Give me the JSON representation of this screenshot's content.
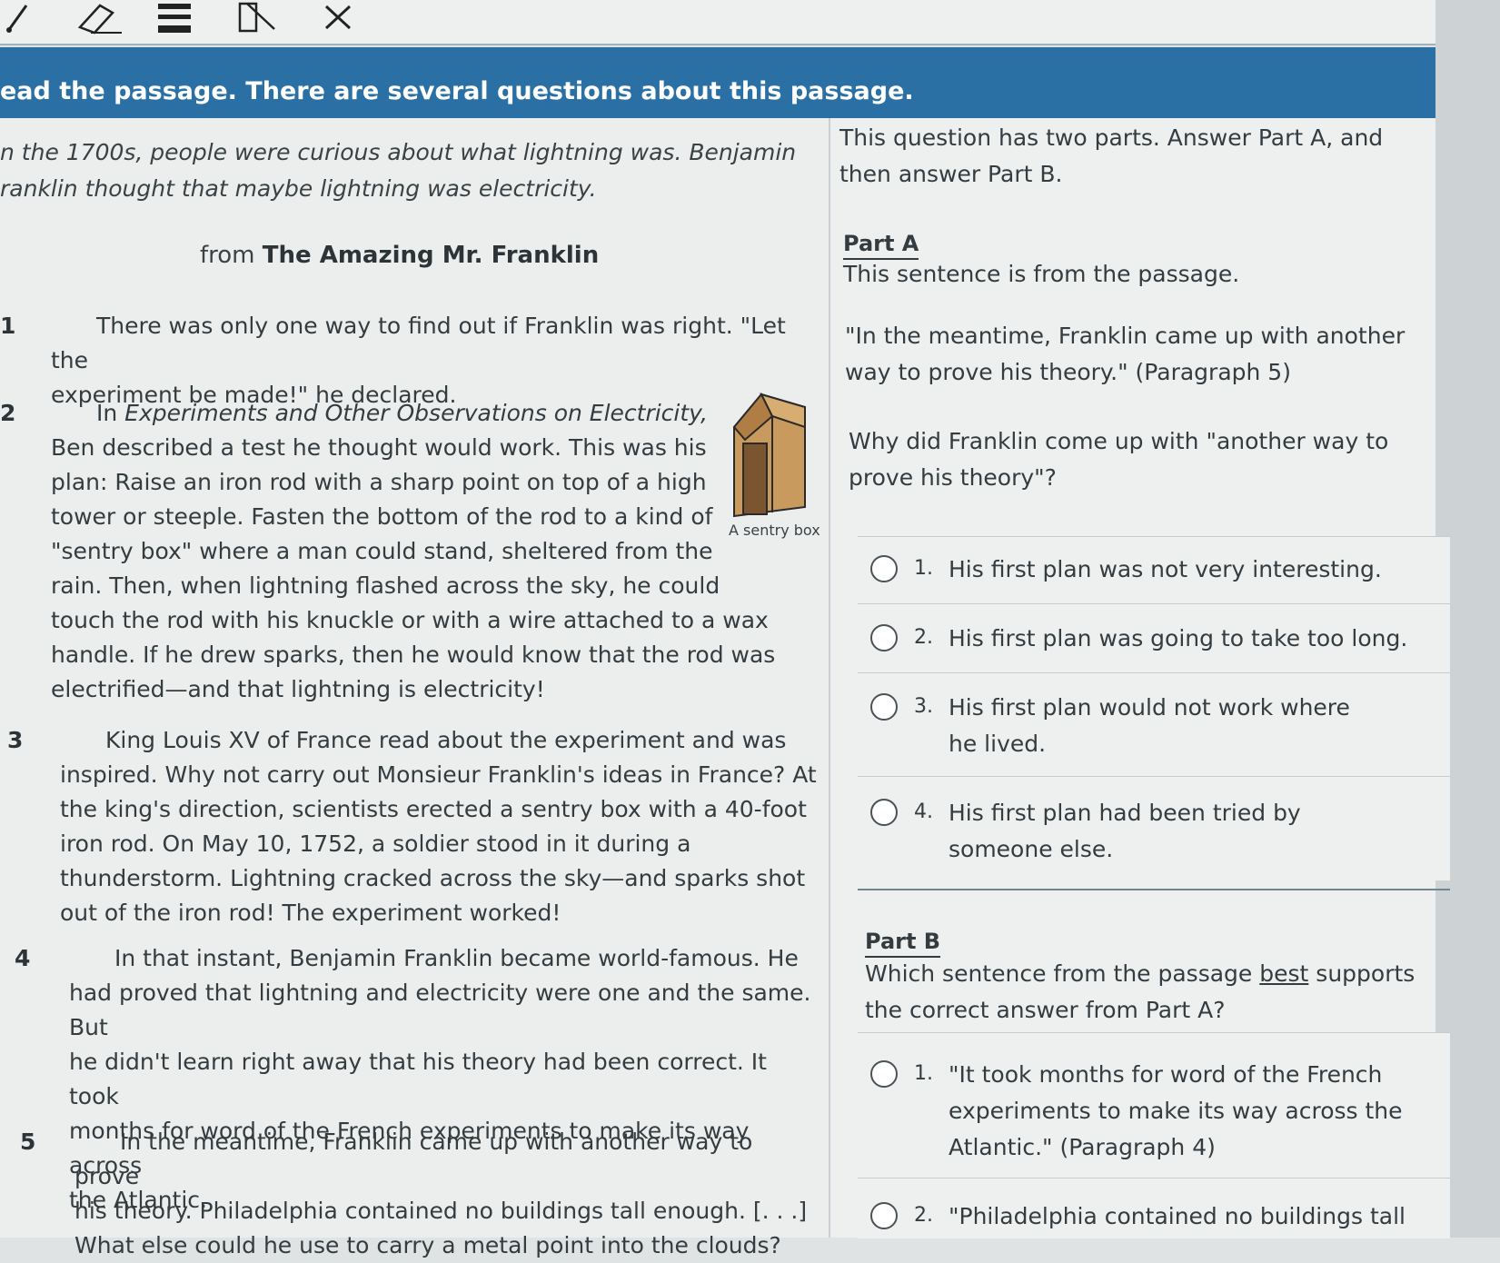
{
  "toolbar": {
    "tools": [
      "pencil-icon",
      "eraser-icon",
      "line-reader-icon",
      "highlighter-icon",
      "close-icon"
    ]
  },
  "banner": {
    "text": "ead the passage. There are several questions about this passage."
  },
  "passage": {
    "intro": "n the 1700s, people were curious about what lightning was. Benjamin ranklin thought that maybe lightning was electricity.",
    "intro_line1": "n the 1700s, people were curious about what lightning was. Benjamin",
    "intro_line2": "ranklin thought that maybe lightning was electricity.",
    "source_prefix": "from ",
    "source_title": "The Amazing Mr. Franklin",
    "paragraphs": [
      {
        "num": "1",
        "lines": [
          "There was only one way to find out if Franklin was right. \"Let the",
          "experiment be made!\" he declared."
        ]
      },
      {
        "num": "2",
        "lines_before": "In ",
        "italic": "Experiments and Other Observations on Electricity,",
        "lines": [
          "Ben described a test he thought would work. This was his",
          "plan: Raise an iron rod with a sharp point on top of a high",
          "tower or steeple. Fasten the bottom of the rod to a kind of",
          "\"sentry box\" where a man could stand, sheltered from the",
          "rain. Then, when lightning flashed across the sky, he could",
          "touch the rod with his knuckle or with a wire attached to a wax",
          "handle. If he drew sparks, then he would know that the rod was",
          "electrified—and that lightning is electricity!"
        ]
      },
      {
        "num": "3",
        "lines": [
          "King Louis XV of France read about the experiment and was",
          "inspired. Why not carry out Monsieur Franklin's ideas in France? At",
          "the king's direction, scientists erected a sentry box with a 40-foot",
          "iron rod. On May 10, 1752, a soldier stood in it during a",
          "thunderstorm. Lightning cracked across the sky—and sparks shot",
          "out of the iron rod! The experiment worked!"
        ]
      },
      {
        "num": "4",
        "lines": [
          "In that instant, Benjamin Franklin became world-famous. He",
          "had proved that lightning and electricity were one and the same. But",
          "he didn't learn right away that his theory had been correct. It took",
          "months for word of the French experiments to make its way across",
          "the Atlantic."
        ]
      },
      {
        "num": "5",
        "lines": [
          "In the meantime, Franklin came up with another way to prove",
          "his theory. Philadelphia contained no buildings tall enough. [. . .]",
          "What else could he use to carry a metal point into the clouds?"
        ]
      }
    ],
    "image_caption": "A sentry box"
  },
  "question": {
    "intro_line1": "This question has two parts. Answer Part A, and",
    "intro_line2": "then answer Part B.",
    "partA": {
      "label": "Part A",
      "prompt": "This sentence is from the passage.",
      "quote_line1": "\"In the meantime, Franklin came up with another",
      "quote_line2": "way to prove his theory.\" (Paragraph 5)",
      "question_line1": "Why did Franklin come up with \"another way to",
      "question_line2": "prove his theory\"?",
      "options": [
        {
          "num": "1.",
          "text": "His first plan was not very interesting."
        },
        {
          "num": "2.",
          "text": "His first plan was going to take too long."
        },
        {
          "num": "3.",
          "text": "His first plan would not work where he lived."
        },
        {
          "num": "4.",
          "text": "His first plan had been tried by someone else."
        }
      ]
    },
    "partB": {
      "label": "Part B",
      "question_line1_pre": "Which sentence from the passage ",
      "question_line1_best": "best",
      "question_line1_post": " supports",
      "question_line2": "the correct answer from Part A?",
      "options": [
        {
          "num": "1.",
          "text": "\"It took months for word of the French experiments to make its way across the Atlantic.\" (Paragraph 4)"
        },
        {
          "num": "2.",
          "text": "\"Philadelphia contained no buildings tall"
        }
      ]
    }
  }
}
